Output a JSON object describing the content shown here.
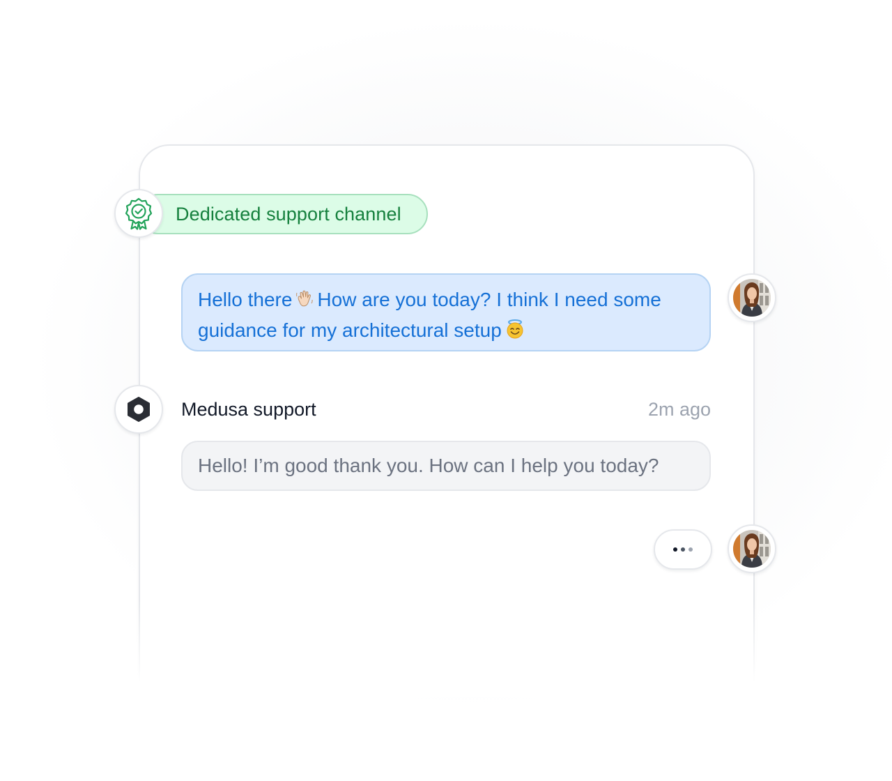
{
  "badge": {
    "label": "Dedicated support channel",
    "icon": "award-badge-check-icon",
    "color": "#15803d"
  },
  "messages": {
    "user_message": {
      "text_part_1": "Hello there",
      "text_part_2": "How are you today? I think I need some guidance for my architectural setup",
      "emoji_1": "waving-hand-icon",
      "emoji_2": "smiling-face-with-halo-icon",
      "color": "#1570d6"
    },
    "support_message": {
      "sender": "Medusa support",
      "time": "2m ago",
      "text": "Hello! I’m good thank you. How can I help you today?",
      "sender_icon": "medusa-logo-icon"
    }
  },
  "typing_indicator": {
    "icon": "typing-dots-icon",
    "dot_colors": [
      "#111827",
      "#4b5563",
      "#9ca3af"
    ]
  },
  "avatar": {
    "icon": "user-avatar-icon"
  }
}
